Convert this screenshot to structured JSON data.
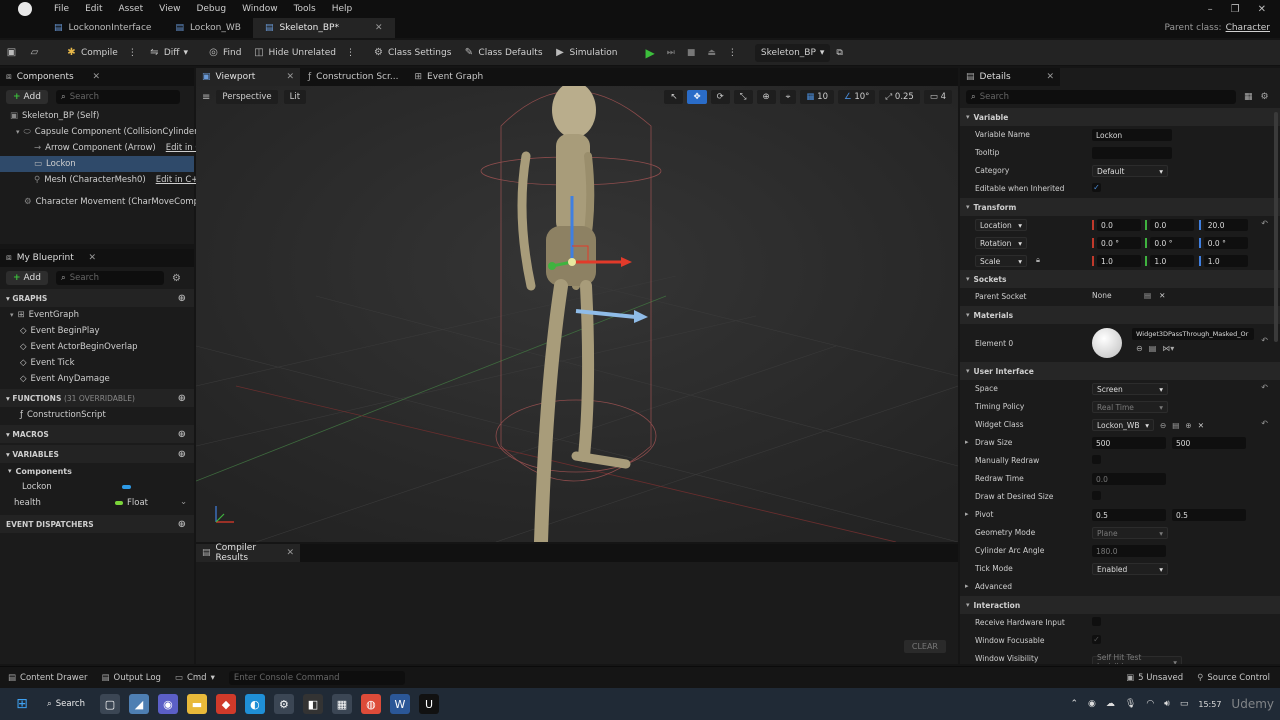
{
  "titlebar": {
    "menu": [
      "File",
      "Edit",
      "Asset",
      "View",
      "Debug",
      "Window",
      "Tools",
      "Help"
    ],
    "parent_class_label": "Parent class:",
    "parent_class_value": "Character"
  },
  "tabs": [
    {
      "label": "LockononInterface"
    },
    {
      "label": "Lockon_WB"
    },
    {
      "label": "Skeleton_BP*"
    }
  ],
  "toolbar": {
    "compile": "Compile",
    "diff": "Diff",
    "find": "Find",
    "hide_unrelated": "Hide Unrelated",
    "class_settings": "Class Settings",
    "class_defaults": "Class Defaults",
    "simulation": "Simulation",
    "debug_object": "Skeleton_BP"
  },
  "components": {
    "tab": "Components",
    "add": "Add",
    "search_placeholder": "Search",
    "items": {
      "self": "Skeleton_BP (Self)",
      "capsule": "Capsule Component (CollisionCylinder)",
      "arrow": "Arrow Component (Arrow)",
      "arrow_edit": "Edit in C++",
      "lockon": "Lockon",
      "mesh": "Mesh (CharacterMesh0)",
      "mesh_edit": "Edit in C++",
      "movement": "Character Movement (CharMoveComp)"
    }
  },
  "my_blueprint": {
    "tab": "My Blueprint",
    "add": "Add",
    "search_placeholder": "Search",
    "graphs_label": "GRAPHS",
    "event_graph": "EventGraph",
    "events": [
      "Event BeginPlay",
      "Event ActorBeginOverlap",
      "Event Tick",
      "Event AnyDamage"
    ],
    "functions_label": "FUNCTIONS",
    "functions_count": "(31 OVERRIDABLE)",
    "construction_script": "ConstructionScript",
    "macros_label": "MACROS",
    "variables_label": "VARIABLES",
    "components_label": "Components",
    "var_lockon": "Lockon",
    "var_health": "health",
    "var_health_type": "Float",
    "dispatchers_label": "EVENT DISPATCHERS"
  },
  "editor_tabs": {
    "viewport": "Viewport",
    "construction": "Construction Scr...",
    "event_graph": "Event Graph"
  },
  "viewport": {
    "perspective": "Perspective",
    "lit": "Lit",
    "grid_snap": "10",
    "rot_snap": "10°",
    "scale_snap": "0.25",
    "camera_speed": "4"
  },
  "compiler": {
    "tab": "Compiler Results",
    "clear": "CLEAR"
  },
  "details": {
    "tab": "Details",
    "search_placeholder": "Search",
    "variable": {
      "section": "Variable",
      "name_label": "Variable Name",
      "name_value": "Lockon",
      "tooltip_label": "Tooltip",
      "category_label": "Category",
      "category_value": "Default",
      "editable_label": "Editable when Inherited"
    },
    "transform": {
      "section": "Transform",
      "location_label": "Location",
      "location": [
        "0.0",
        "0.0",
        "20.0"
      ],
      "rotation_label": "Rotation",
      "rotation": [
        "0.0 °",
        "0.0 °",
        "0.0 °"
      ],
      "scale_label": "Scale",
      "scale": [
        "1.0",
        "1.0",
        "1.0"
      ]
    },
    "sockets": {
      "section": "Sockets",
      "parent_label": "Parent Socket",
      "parent_value": "None"
    },
    "materials": {
      "section": "Materials",
      "element_label": "Element 0",
      "material_name": "Widget3DPassThrough_Masked_Or"
    },
    "user_interface": {
      "section": "User Interface",
      "space_label": "Space",
      "space_value": "Screen",
      "timing_label": "Timing Policy",
      "timing_value": "Real Time",
      "widget_class_label": "Widget Class",
      "widget_class_value": "Lockon_WB",
      "draw_size_label": "Draw Size",
      "draw_size": [
        "500",
        "500"
      ],
      "manual_redraw_label": "Manually Redraw",
      "redraw_time_label": "Redraw Time",
      "redraw_time_value": "0.0",
      "draw_desired_label": "Draw at Desired Size",
      "pivot_label": "Pivot",
      "pivot": [
        "0.5",
        "0.5"
      ],
      "geometry_label": "Geometry Mode",
      "geometry_value": "Plane",
      "cylinder_label": "Cylinder Arc Angle",
      "cylinder_value": "180.0",
      "tick_label": "Tick Mode",
      "tick_value": "Enabled",
      "advanced_label": "Advanced"
    },
    "interaction": {
      "section": "Interaction",
      "hardware_label": "Receive Hardware Input",
      "focusable_label": "Window Focusable",
      "visibility_label": "Window Visibility",
      "visibility_value": "Self Hit Test Invisible"
    }
  },
  "statusbar": {
    "content_drawer": "Content Drawer",
    "output_log": "Output Log",
    "cmd": "Cmd",
    "console_placeholder": "Enter Console Command",
    "unsaved": "5 Unsaved",
    "source_control": "Source Control"
  },
  "taskbar": {
    "search": "Search",
    "time": "15:57",
    "watermark": "Udemy"
  },
  "colors": {
    "accent_blue": "#2f4a6a",
    "play_green": "#3cbf3c",
    "axis_x": "#e23a2a",
    "axis_y": "#3fb33f",
    "axis_z": "#3f7fe0"
  }
}
